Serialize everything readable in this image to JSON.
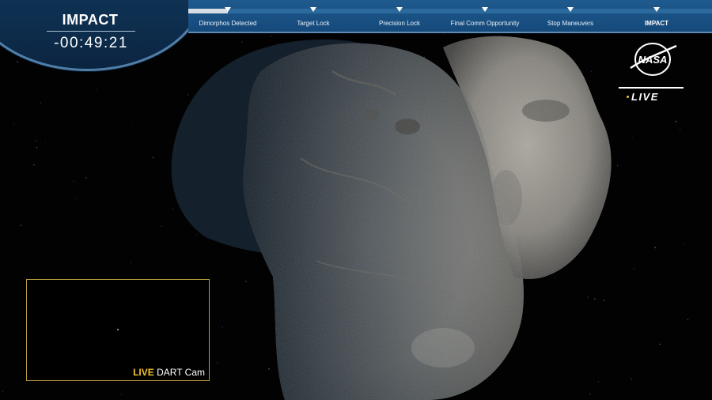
{
  "countdown": {
    "title": "IMPACT",
    "time": "-00:49:21"
  },
  "timeline": {
    "progress_fraction": 0.03,
    "milestones": [
      {
        "label": "Dimorphos Detected"
      },
      {
        "label": "Target Lock"
      },
      {
        "label": "Precision Lock"
      },
      {
        "label": "Final Comm Opportunity"
      },
      {
        "label": "Stop Maneuvers"
      },
      {
        "label": "IMPACT"
      }
    ]
  },
  "branding": {
    "logo_text": "NASA",
    "live_label": "LIVE",
    "live_dot_color": "#f2c232"
  },
  "inset": {
    "live_label": "LIVE",
    "camera_name": "DART Cam",
    "border_color": "#b89b3a"
  },
  "colors": {
    "timeline_bar": "#1f5a8e",
    "badge": "#123a5e",
    "accent_yellow": "#f2c232"
  }
}
